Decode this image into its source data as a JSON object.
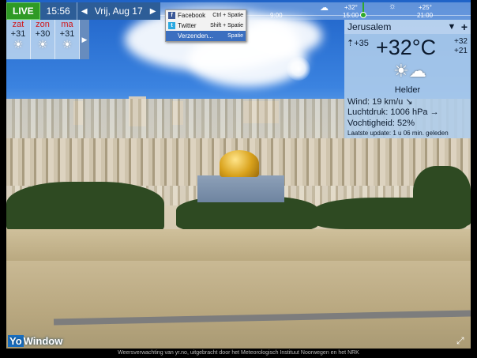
{
  "topbar": {
    "live_label": "LIVE",
    "time": "15:56",
    "prev_icon": "triangle-left-icon",
    "next_icon": "triangle-right-icon",
    "date": "Vrij, Aug 17"
  },
  "timeline": {
    "time_9": "9:00",
    "now_temp": "+32°",
    "now_time": "15:00",
    "later_temp": "+25°",
    "later_time": "21:00"
  },
  "forecast": [
    {
      "day": "zat",
      "temp": "+31",
      "icon": "sun-icon"
    },
    {
      "day": "zon",
      "temp": "+30",
      "icon": "sun-icon"
    },
    {
      "day": "ma",
      "temp": "+31",
      "icon": "sun-icon"
    }
  ],
  "share_menu": {
    "items": [
      {
        "label": "Facebook",
        "shortcut": "Ctrl + Spatie",
        "icon": "facebook-icon"
      },
      {
        "label": "Twitter",
        "shortcut": "Shift + Spatie",
        "icon": "twitter-icon"
      },
      {
        "label": "Verzenden...",
        "shortcut": "Spatie",
        "icon": ""
      }
    ]
  },
  "panel": {
    "city": "Jerusalem",
    "feels": "+35",
    "temp": "+32°C",
    "max": "+32",
    "min": "+21",
    "condition": "Helder",
    "wind": "Wind:  19 km/u",
    "pressure": "Luchtdruk:  1006 hPa",
    "humidity": "Vochtigheid:  52%",
    "updated": "Laatste update:  1 u 06 min. geleden"
  },
  "footer": {
    "text": "Weersverwachting van yr.no, uitgebracht door het Meteorologisch Instituut Noorwegen en het NRK"
  },
  "logo": {
    "yo": "Yo",
    "window": "Window"
  },
  "colors": {
    "live": "#2f9a25",
    "accent": "#2d5d97",
    "day": "#d0161a"
  }
}
